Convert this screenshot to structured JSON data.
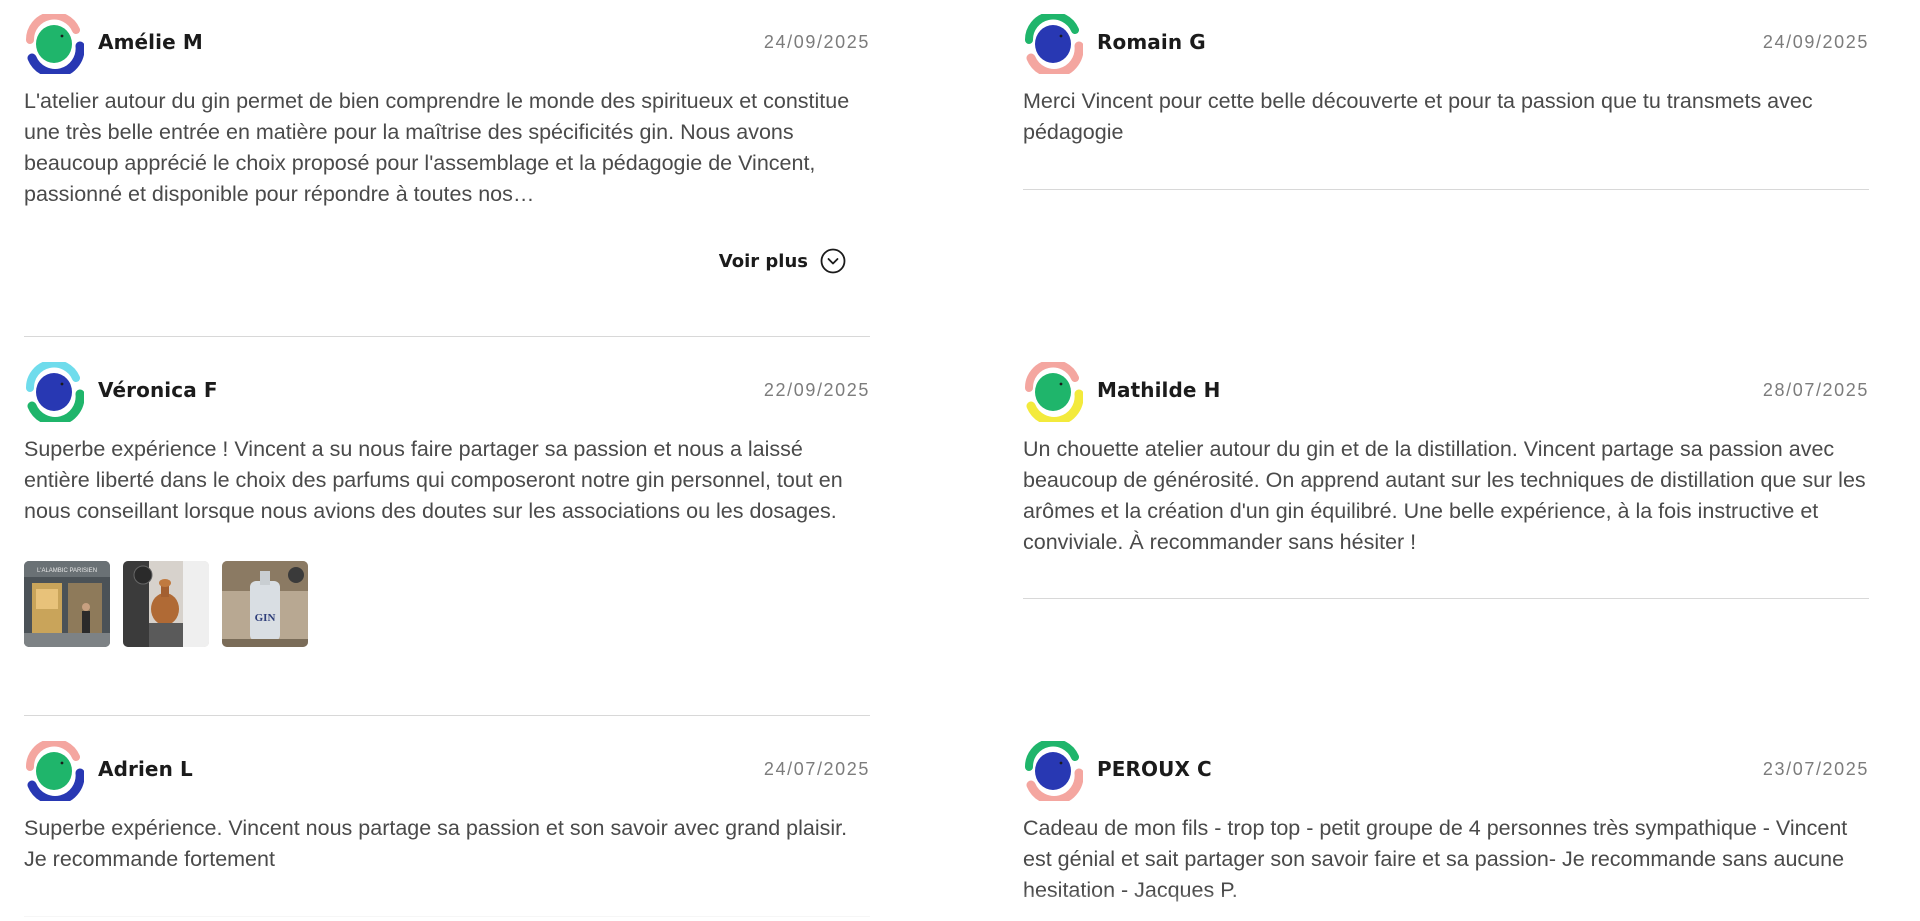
{
  "reviews": [
    {
      "name": "Amélie M",
      "date": "24/09/2025",
      "text": "L'atelier autour du gin permet de bien comprendre le monde des spiritueux et constitue une très belle entrée en matière pour la maîtrise des spécificités gin. Nous avons beaucoup apprécié le choix proposé pour l'assemblage et la pédagogie de Vincent, passionné et disponible pour répondre à toutes nos…",
      "more_label": "Voir plus",
      "avatar": {
        "top": "#f4a6a0",
        "center": "#1fb56b",
        "bottom": "#2838b3"
      }
    },
    {
      "name": "Romain G",
      "date": "24/09/2025",
      "text": "Merci Vincent pour cette belle découverte et pour ta passion que tu transmets avec pédagogie",
      "avatar": {
        "top": "#1fb56b",
        "center": "#2838b3",
        "bottom": "#f4a6a0"
      }
    },
    {
      "name": "Véronica F",
      "date": "22/09/2025",
      "text": "Superbe expérience ! Vincent a su nous faire partager sa passion et nous a laissé entière liberté dans le choix des parfums qui composeront notre gin personnel, tout en nous conseillant lorsque nous avions des doutes sur les associations ou les dosages.",
      "photos": [
        "L'ALAMBIC PARISIEN",
        "distillery-alembic",
        "GIN"
      ],
      "avatar": {
        "top": "#6fdcec",
        "center": "#2838b3",
        "bottom": "#1fb56b"
      }
    },
    {
      "name": "Mathilde H",
      "date": "28/07/2025",
      "text": "Un chouette atelier autour du gin et de la distillation. Vincent partage sa passion avec beaucoup de générosité. On apprend autant sur les techniques de distillation que sur les arômes et la création d'un gin équilibré. Une belle expérience, à la fois instructive et conviviale. À recommander sans hésiter !",
      "avatar": {
        "top": "#f4a6a0",
        "center": "#1fb56b",
        "bottom": "#f3ea3c"
      }
    },
    {
      "name": "Adrien L",
      "date": "24/07/2025",
      "text": "Superbe expérience. Vincent nous partage sa passion et son savoir avec grand plaisir. Je recommande fortement",
      "avatar": {
        "top": "#f4a6a0",
        "center": "#1fb56b",
        "bottom": "#2838b3"
      }
    },
    {
      "name": "PEROUX C",
      "date": "23/07/2025",
      "text": "Cadeau de mon fils - trop top - petit groupe de 4 personnes très sympathique - Vincent est génial et sait partager son savoir faire et sa passion- Je recommande sans aucune hesitation - Jacques P.",
      "avatar": {
        "top": "#1fb56b",
        "center": "#2838b3",
        "bottom": "#f4a6a0"
      }
    }
  ]
}
